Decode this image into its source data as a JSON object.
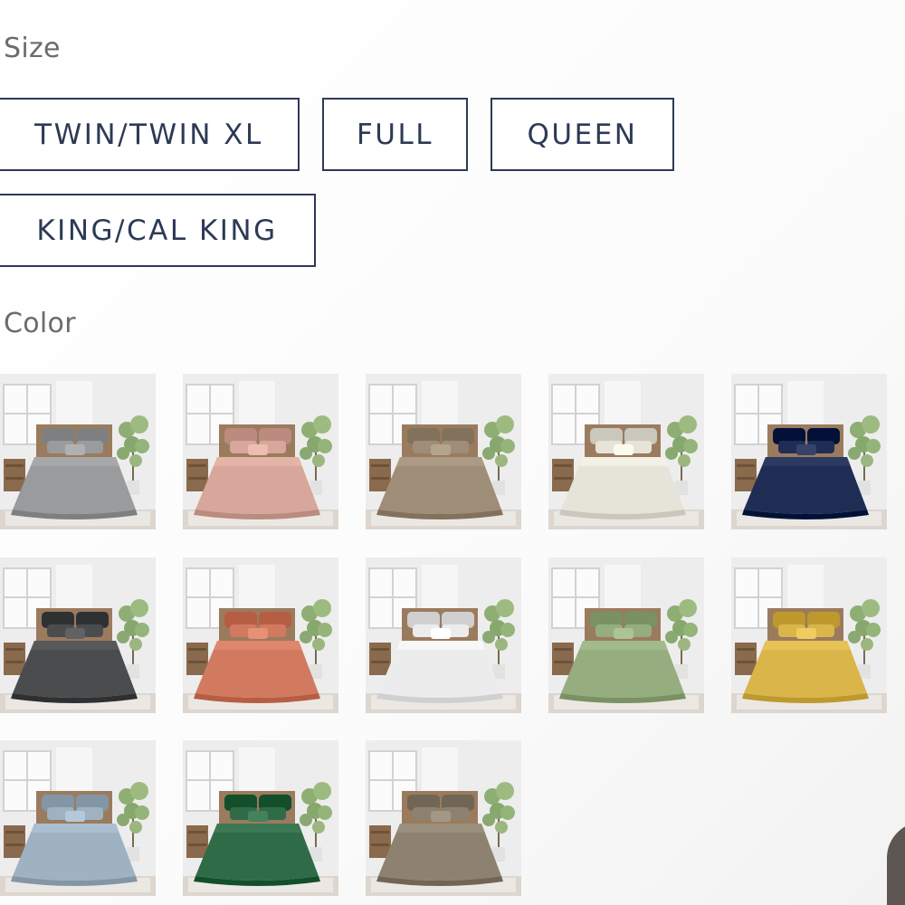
{
  "size": {
    "label": "Size",
    "options": [
      "TWIN/TWIN XL",
      "FULL",
      "QUEEN",
      "KING/CAL KING"
    ]
  },
  "color": {
    "label": "Color",
    "swatches": [
      {
        "color": "#9a9b9d"
      },
      {
        "color": "#d6a79a"
      },
      {
        "color": "#9e8e78"
      },
      {
        "color": "#e6e3d8"
      },
      {
        "color": "#1f2d55"
      },
      {
        "color": "#4b4c4e"
      },
      {
        "color": "#d27a60"
      },
      {
        "color": "#ececec"
      },
      {
        "color": "#95ad7f"
      },
      {
        "color": "#d9b54a"
      },
      {
        "color": "#9fb2c2"
      },
      {
        "color": "#2f6b47"
      },
      {
        "color": "#8d8270"
      }
    ]
  }
}
